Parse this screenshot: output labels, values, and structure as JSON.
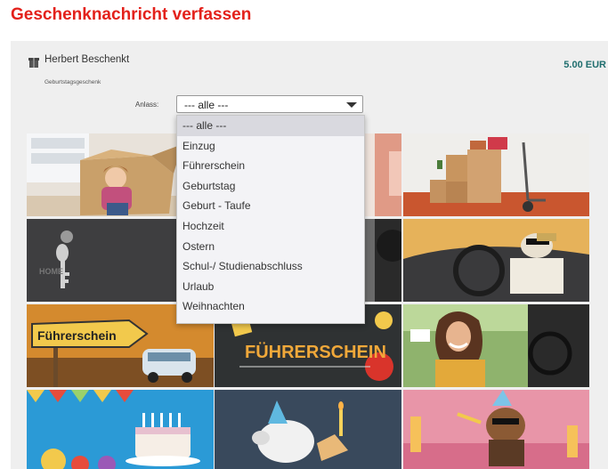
{
  "header": {
    "title": "Geschenknachricht verfassen"
  },
  "gift": {
    "recipient": "Herbert Beschenkt",
    "occasion": "Geburtstagsgeschenk",
    "price": "5.00 EUR"
  },
  "filter": {
    "label": "Anlass:",
    "selected": "--- alle ---",
    "options": [
      "--- alle ---",
      "Einzug",
      "Führerschein",
      "Geburtstag",
      "Geburt - Taufe",
      "Hochzeit",
      "Ostern",
      "Schul-/ Studienabschluss",
      "Urlaub",
      "Weihnachten"
    ]
  },
  "tiles": [
    {
      "name": "einzug-child-box"
    },
    {
      "name": "einzug-hidden"
    },
    {
      "name": "einzug-moving-boxes"
    },
    {
      "name": "einzug-key"
    },
    {
      "name": "fuehrerschein-hidden"
    },
    {
      "name": "fuehrerschein-dog-car"
    },
    {
      "name": "fuehrerschein-sign",
      "text": "Führerschein"
    },
    {
      "name": "fuehrerschein-chalkboard",
      "text": "FÜHRERSCHEIN"
    },
    {
      "name": "fuehrerschein-woman-car"
    },
    {
      "name": "geburtstag-cake"
    },
    {
      "name": "geburtstag-piggy"
    },
    {
      "name": "geburtstag-party-dog"
    }
  ],
  "colors": {
    "title": "#e3211b",
    "price": "#1f6e6e",
    "panel": "#efefef"
  }
}
